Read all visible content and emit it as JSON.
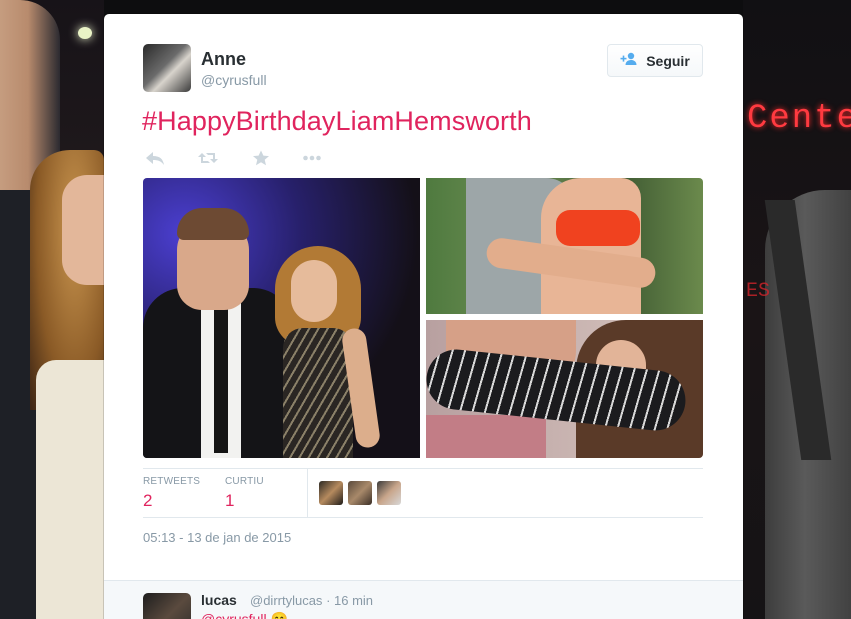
{
  "tweet": {
    "author_name": "Anne",
    "author_handle": "@cyrusfull",
    "follow_label": "Seguir",
    "text": "#HappyBirthdayLiamHemsworth",
    "stats": {
      "retweets_label": "RETWEETS",
      "retweets_value": "2",
      "favorites_label": "CURTIU",
      "favorites_value": "1"
    },
    "timestamp": "05:13 - 13 de jan de 2015"
  },
  "reply": {
    "name": "lucas",
    "handle": "@dirrtylucas",
    "time": "· 16 min",
    "text": "@cyrusfull 😊"
  },
  "background": {
    "neon_text": "Cente",
    "neon_text_2": "ES"
  },
  "icons": {
    "follow": "add-user-icon",
    "reply": "reply-icon",
    "retweet": "retweet-icon",
    "favorite": "star-icon",
    "more": "more-icon"
  },
  "colors": {
    "accent": "#e0245e",
    "muted": "#8899a6",
    "action_icon": "#ccd6dd",
    "follow_icon": "#55acee"
  }
}
